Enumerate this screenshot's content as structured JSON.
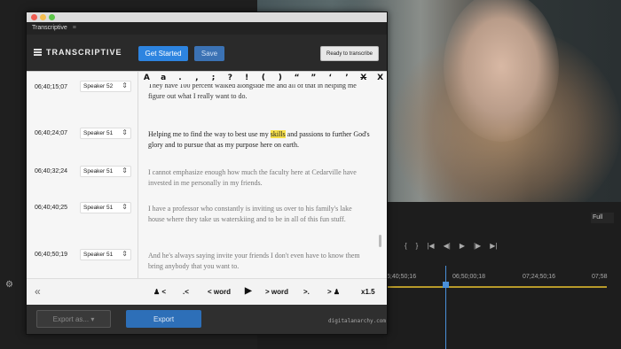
{
  "window": {
    "panel_title": "Transcriptive",
    "brand": "TRANSCRIPTIVE"
  },
  "header": {
    "get_started": "Get Started",
    "save": "Save",
    "ready": "Ready to transcribe"
  },
  "toolbar": [
    "A",
    "a",
    ".",
    ",",
    ";",
    "?",
    "!",
    "(",
    ")",
    "“",
    "”",
    "‘",
    "’",
    "X",
    "X"
  ],
  "rows": [
    {
      "timecode": "06;40;24;07",
      "speaker": "Speaker 51",
      "pre": "Helping me to find the way to best use my ",
      "highlight": "skills",
      "post": " and passions to further God's glory and to pursue that as my purpose here on earth."
    },
    {
      "timecode": "06;40;32;24",
      "speaker": "Speaker 51",
      "pre": "I cannot emphasize enough how much the faculty here at Cedarville have invested in me personally in my friends.",
      "highlight": "",
      "post": ""
    },
    {
      "timecode": "06;40;40;25",
      "speaker": "Speaker 51",
      "pre": "I have a professor who constantly is inviting us over to his family's lake house where they take us waterskiing and to be in all of this fun stuff.",
      "highlight": "",
      "post": ""
    },
    {
      "timecode": "06;40;50;19",
      "speaker": "Speaker 51",
      "pre": "And he's always saying invite your friends I don't even have to know them bring anybody that you want to.",
      "highlight": "",
      "post": ""
    }
  ],
  "cutoff": {
    "timecode": "06;40;15;07",
    "speaker": "Speaker 52",
    "text": "They have 100 percent walked alongside me and all of that in helping me figure out what I really want to do."
  },
  "controls": {
    "prev_speaker": "<",
    "prev_sentence": ".<",
    "prev_word": "< word",
    "next_word": "> word",
    "next_sentence": ">.",
    "next_speaker": ">",
    "speed": "x1.5"
  },
  "footer": {
    "export_as": "Export as...",
    "export": "Export",
    "credit": "digitalanarchy.com"
  },
  "editor": {
    "fit": "Full",
    "times": [
      "6;40;50;16",
      "06;50;00;18",
      "07;24;50;16",
      "07;58"
    ]
  },
  "colors": {
    "accent": "#2d84e0",
    "highlight": "#f7e04a"
  }
}
